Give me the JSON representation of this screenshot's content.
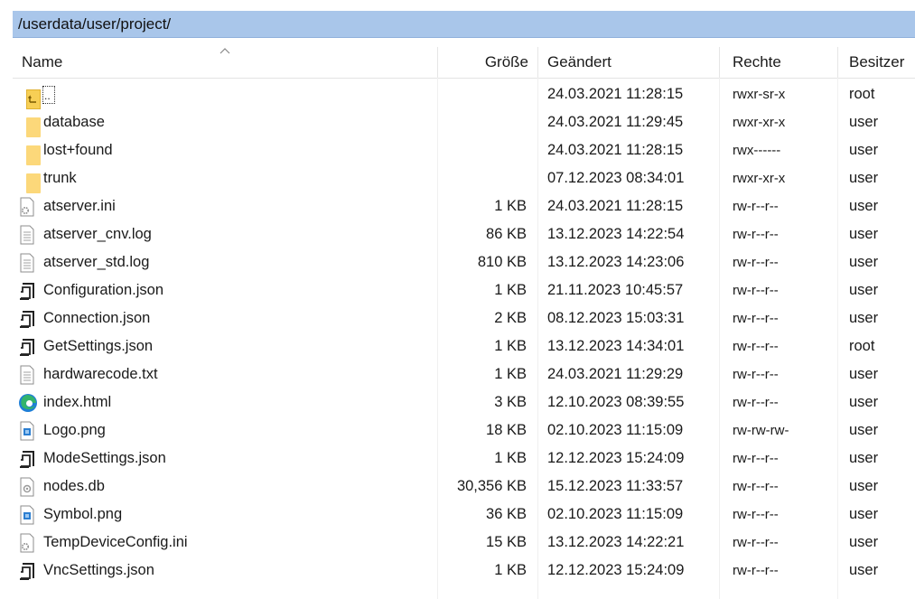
{
  "path": "/userdata/user/project/",
  "columns": {
    "name": "Name",
    "size": "Größe",
    "modified": "Geändert",
    "rights": "Rechte",
    "owner": "Besitzer"
  },
  "files": [
    {
      "icon": "parent-dir-icon",
      "name": "..",
      "size": "",
      "modified": "24.03.2021 11:28:15",
      "rights": "rwxr-sr-x",
      "owner": "root"
    },
    {
      "icon": "folder-icon",
      "name": "database",
      "size": "",
      "modified": "24.03.2021 11:29:45",
      "rights": "rwxr-xr-x",
      "owner": "user"
    },
    {
      "icon": "folder-icon",
      "name": "lost+found",
      "size": "",
      "modified": "24.03.2021 11:28:15",
      "rights": "rwx------",
      "owner": "user"
    },
    {
      "icon": "folder-icon",
      "name": "trunk",
      "size": "",
      "modified": "07.12.2023 08:34:01",
      "rights": "rwxr-xr-x",
      "owner": "user"
    },
    {
      "icon": "settings-file-icon",
      "name": "atserver.ini",
      "size": "1 KB",
      "modified": "24.03.2021 11:28:15",
      "rights": "rw-r--r--",
      "owner": "user"
    },
    {
      "icon": "text-file-icon",
      "name": "atserver_cnv.log",
      "size": "86 KB",
      "modified": "13.12.2023 14:22:54",
      "rights": "rw-r--r--",
      "owner": "user"
    },
    {
      "icon": "text-file-icon",
      "name": "atserver_std.log",
      "size": "810 KB",
      "modified": "13.12.2023 14:23:06",
      "rights": "rw-r--r--",
      "owner": "user"
    },
    {
      "icon": "json-file-icon",
      "name": "Configuration.json",
      "size": "1 KB",
      "modified": "21.11.2023 10:45:57",
      "rights": "rw-r--r--",
      "owner": "user"
    },
    {
      "icon": "json-file-icon",
      "name": "Connection.json",
      "size": "2 KB",
      "modified": "08.12.2023 15:03:31",
      "rights": "rw-r--r--",
      "owner": "user"
    },
    {
      "icon": "json-file-icon",
      "name": "GetSettings.json",
      "size": "1 KB",
      "modified": "13.12.2023 14:34:01",
      "rights": "rw-r--r--",
      "owner": "root"
    },
    {
      "icon": "text-file-icon",
      "name": "hardwarecode.txt",
      "size": "1 KB",
      "modified": "24.03.2021 11:29:29",
      "rights": "rw-r--r--",
      "owner": "user"
    },
    {
      "icon": "edge-browser-icon",
      "name": "index.html",
      "size": "3 KB",
      "modified": "12.10.2023 08:39:55",
      "rights": "rw-r--r--",
      "owner": "user"
    },
    {
      "icon": "image-file-icon",
      "name": "Logo.png",
      "size": "18 KB",
      "modified": "02.10.2023 11:15:09",
      "rights": "rw-rw-rw-",
      "owner": "user"
    },
    {
      "icon": "json-file-icon",
      "name": "ModeSettings.json",
      "size": "1 KB",
      "modified": "12.12.2023 15:24:09",
      "rights": "rw-r--r--",
      "owner": "user"
    },
    {
      "icon": "database-file-icon",
      "name": "nodes.db",
      "size": "30,356 KB",
      "modified": "15.12.2023 11:33:57",
      "rights": "rw-r--r--",
      "owner": "user"
    },
    {
      "icon": "image-file-icon",
      "name": "Symbol.png",
      "size": "36 KB",
      "modified": "02.10.2023 11:15:09",
      "rights": "rw-r--r--",
      "owner": "user"
    },
    {
      "icon": "settings-file-icon",
      "name": "TempDeviceConfig.ini",
      "size": "15 KB",
      "modified": "13.12.2023 14:22:21",
      "rights": "rw-r--r--",
      "owner": "user"
    },
    {
      "icon": "json-file-icon",
      "name": "VncSettings.json",
      "size": "1 KB",
      "modified": "12.12.2023 15:24:09",
      "rights": "rw-r--r--",
      "owner": "user"
    }
  ],
  "colors": {
    "pathbar_bg": "#a9c6ea",
    "folder": "#fcd87a",
    "edge_blue": "#1e7fd6",
    "edge_green": "#33b46c"
  }
}
